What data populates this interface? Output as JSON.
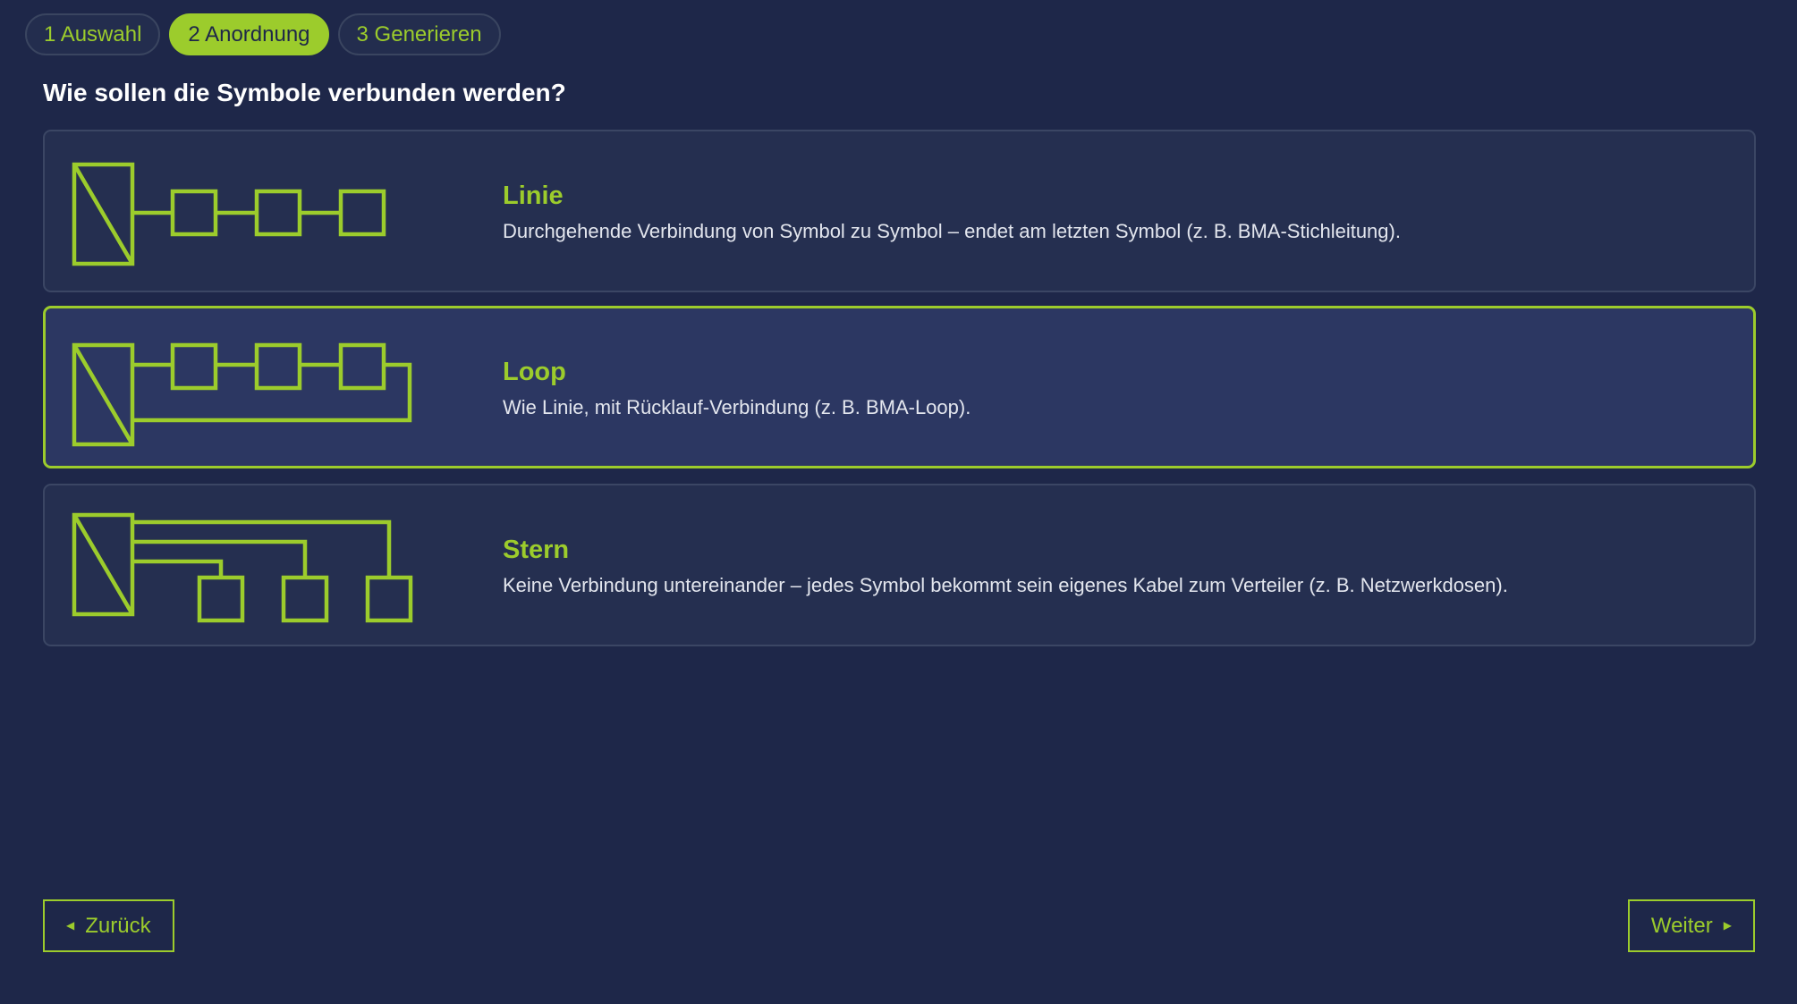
{
  "steps": [
    {
      "label": "1 Auswahl",
      "active": false
    },
    {
      "label": "2 Anordnung",
      "active": true
    },
    {
      "label": "3 Generieren",
      "active": false
    }
  ],
  "question": "Wie sollen die Symbole verbunden werden?",
  "options": [
    {
      "title": "Linie",
      "description": "Durchgehende Verbindung von Symbol zu Symbol – endet am letzten Symbol (z. B. BMA-Stichleitung).",
      "selected": false,
      "icon": "line-topology-icon"
    },
    {
      "title": "Loop",
      "description": "Wie Linie, mit Rücklauf-Verbindung (z. B. BMA-Loop).",
      "selected": true,
      "icon": "loop-topology-icon"
    },
    {
      "title": "Stern",
      "description": "Keine Verbindung untereinander – jedes Symbol bekommt sein eigenes Kabel zum Verteiler (z. B. Netzwerkdosen).",
      "selected": false,
      "icon": "star-topology-icon"
    }
  ],
  "buttons": {
    "back_label": "Zurück",
    "next_label": "Weiter",
    "back_icon": "caret-left-icon",
    "next_icon": "caret-right-icon"
  },
  "colors": {
    "background": "#1e2749",
    "accent": "#9ccc2c",
    "card": "#252f50",
    "card_selected": "#2c3762",
    "text": "#e3e6ee"
  }
}
